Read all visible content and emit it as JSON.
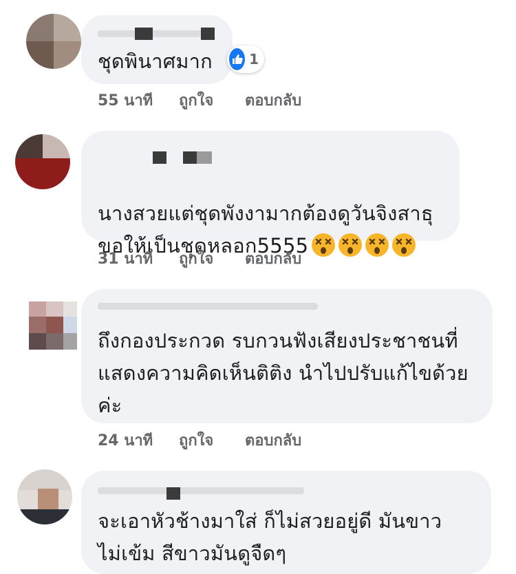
{
  "comments": [
    {
      "text": "ชุดพินาศมาก",
      "reaction": {
        "icon": "thumbs-up-icon",
        "count": "1",
        "color": "#1877f2"
      },
      "time": "55 นาที",
      "like": "ถูกใจ",
      "reply": "ตอบกลับ"
    },
    {
      "text": "นางสวยแต่ชุดพังงามากต้องดูวันจิงสาธุ\nขอให้เป็นชุดหลอก5555",
      "emojis": [
        "dizzy-face-icon",
        "dizzy-face-icon",
        "dizzy-face-icon",
        "dizzy-face-icon"
      ],
      "time": "31 นาที",
      "like": "ถูกใจ",
      "reply": "ตอบกลับ"
    },
    {
      "text": "ถึงกองประกวด รบกวนฟังเสียงประชาชนที่\nแสดงความคิดเห็นติติง นำไปปรับแก้ไขด้วย\nค่ะ",
      "time": "24 นาที",
      "like": "ถูกใจ",
      "reply": "ตอบกลับ"
    },
    {
      "text": "จะเอาหัวช้างมาใส่ ก็ไม่สวยอยู่ดี มันขาว\nไม่เข้ม สีขาวมันดูจืดๆ"
    }
  ],
  "colors": {
    "bubble": "#f0f2f5",
    "meta": "#65676b",
    "emoji": "#f7b52a"
  }
}
